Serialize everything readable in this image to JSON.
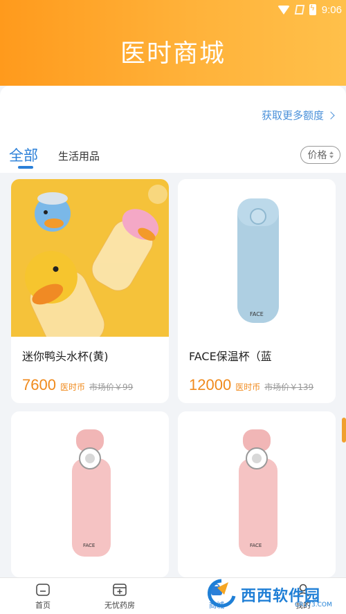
{
  "status_bar": {
    "time": "9:06"
  },
  "header": {
    "title": "医时商城"
  },
  "quota": {
    "link_label": "获取更多额度"
  },
  "tabs": {
    "items": [
      {
        "label": "全部",
        "active": true
      },
      {
        "label": "生活用品",
        "active": false
      }
    ],
    "sort_label": "价格"
  },
  "products": [
    {
      "name": "迷你鸭头水杯(黄)",
      "price": "7600",
      "unit": "医时币",
      "market_price": "市场价￥99"
    },
    {
      "name": "FACE保温杯（蓝",
      "price": "12000",
      "unit": "医时币",
      "market_price": "市场价￥139"
    },
    {
      "name": "",
      "price": "",
      "unit": "",
      "market_price": ""
    },
    {
      "name": "",
      "price": "",
      "unit": "",
      "market_price": ""
    }
  ],
  "bottom_nav": [
    {
      "label": "首页",
      "icon": "home-icon"
    },
    {
      "label": "无忧药房",
      "icon": "pharmacy-icon"
    },
    {
      "label": "商城",
      "icon": "mall-icon",
      "active": true
    },
    {
      "label": "我的",
      "icon": "profile-icon"
    }
  ],
  "watermark": {
    "text": "西西软件园",
    "sub": "CR173.COM"
  },
  "colors": {
    "accent": "#f08a1c",
    "header": "#ffb23a",
    "active_tab": "#2a7fd8",
    "link": "#4a90d9"
  }
}
